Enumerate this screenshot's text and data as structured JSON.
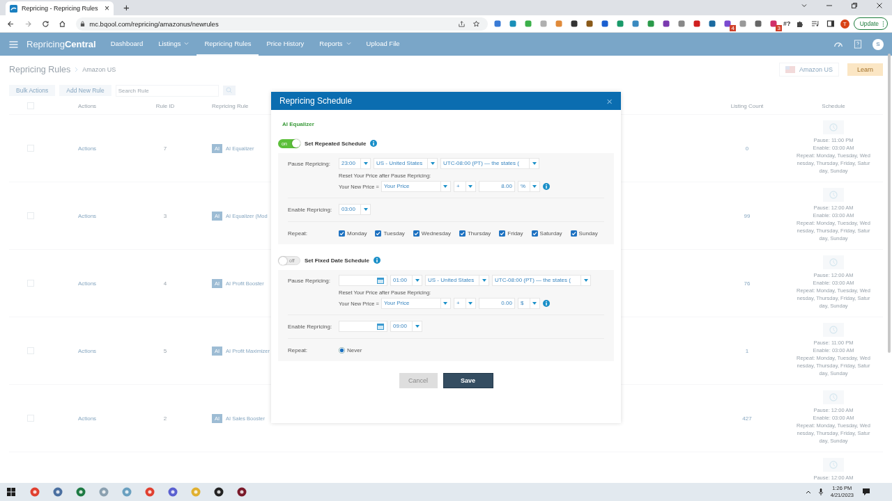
{
  "browser": {
    "tab": {
      "title": "Repricing - Repricing Rules",
      "close": "×"
    },
    "new_tab": "+",
    "url": "mc.bqool.com/repricing/amazonus/newrules",
    "extensions": [
      {
        "kind": "icon"
      },
      {
        "kind": "icon"
      },
      {
        "kind": "icon"
      },
      {
        "kind": "icon"
      },
      {
        "kind": "icon"
      },
      {
        "kind": "icon"
      },
      {
        "kind": "icon"
      },
      {
        "kind": "icon"
      },
      {
        "kind": "icon"
      },
      {
        "kind": "icon"
      },
      {
        "kind": "icon"
      },
      {
        "kind": "icon"
      },
      {
        "kind": "icon"
      },
      {
        "kind": "icon"
      },
      {
        "kind": "icon"
      },
      {
        "kind": "icon",
        "badge": "4"
      },
      {
        "kind": "icon"
      },
      {
        "kind": "icon"
      },
      {
        "kind": "icon",
        "badge": "3"
      },
      {
        "kind": "text",
        "label": "#?"
      }
    ],
    "profile": "T",
    "update_button": "Update"
  },
  "app_nav": {
    "logo_light": "Repricing",
    "logo_bold": "Central",
    "items": [
      {
        "label": "Dashboard",
        "dropdown": false,
        "selected": false
      },
      {
        "label": "Listings",
        "dropdown": true,
        "selected": false
      },
      {
        "label": "Repricing Rules",
        "dropdown": false,
        "selected": true
      },
      {
        "label": "Price History",
        "dropdown": false,
        "selected": false
      },
      {
        "label": "Reports",
        "dropdown": true,
        "selected": false
      },
      {
        "label": "Upload File",
        "dropdown": false,
        "selected": false
      }
    ],
    "avatar": "S"
  },
  "page": {
    "title": "Repricing Rules",
    "breadcrumb": "Amazon US",
    "marketplace": "Amazon US",
    "learn_button": "Learn",
    "bulk_actions": "Bulk Actions",
    "add_rule": "Add New Rule",
    "search_placeholder": "Search Rule"
  },
  "table": {
    "columns": [
      {
        "kind": "checkbox",
        "checked": false
      },
      {
        "kind": "text",
        "label": "Actions"
      },
      {
        "kind": "text",
        "label": "Rule ID"
      },
      {
        "kind": "text",
        "label": "Repricing Rule"
      },
      {
        "kind": "text",
        "label": "Listing Count"
      },
      {
        "kind": "text",
        "label": "Schedule"
      }
    ],
    "rows": [
      {
        "checked": false,
        "actions": "Actions",
        "rule_id": "7",
        "badge": "AI",
        "rule": "AI Equalizer",
        "listing_count": "0",
        "schedule": [
          "Pause: 11:00 PM",
          "Enable: 03:00 AM",
          "Repeat: Monday, Tuesday, Wednesday, Thursday, Friday, Saturday, Sunday"
        ]
      },
      {
        "checked": false,
        "actions": "Actions",
        "rule_id": "3",
        "badge": "AI",
        "rule": "AI Equalizer (Mod",
        "listing_count": "99",
        "schedule": [
          "Pause: 12:00 AM",
          "Enable: 03:00 AM",
          "Repeat: Monday, Tuesday, Wednesday, Thursday, Friday, Saturday, Sunday"
        ]
      },
      {
        "checked": false,
        "actions": "Actions",
        "rule_id": "4",
        "badge": "AI",
        "rule": "AI Profit Booster",
        "listing_count": "76",
        "schedule": [
          "Pause: 12:00 AM",
          "Enable: 03:00 AM",
          "Repeat: Monday, Tuesday, Wednesday, Thursday, Friday, Saturday, Sunday"
        ]
      },
      {
        "checked": false,
        "actions": "Actions",
        "rule_id": "5",
        "badge": "AI",
        "rule": "AI Profit Maximizer",
        "listing_count": "1",
        "schedule": [
          "Pause: 11:00 PM",
          "Enable: 03:00 AM",
          "Repeat: Monday, Tuesday, Wednesday, Thursday, Friday, Saturday, Sunday"
        ]
      },
      {
        "checked": false,
        "actions": "Actions",
        "rule_id": "2",
        "badge": "AI",
        "rule": "AI Sales Booster",
        "listing_count": "427",
        "schedule": [
          "Pause: 12:00 AM",
          "Enable: 03:00 AM",
          "Repeat: Monday, Tuesday, Wednesday, Thursday, Friday, Saturday, Sunday"
        ]
      },
      {
        "schedule": [
          "Pause: 12:00 AM"
        ]
      }
    ]
  },
  "modal": {
    "title": "Repricing Schedule",
    "close": "×",
    "rule_name": "AI Equalizer",
    "schedules": [
      {
        "on": true,
        "toggle_text": "on",
        "title": "Set Repeated Schedule",
        "pause_label": "Pause Repricing:",
        "pause_fields": [
          {
            "kind": "select",
            "value": "23:00"
          },
          {
            "kind": "select",
            "value": "US - United States"
          },
          {
            "kind": "select",
            "value": "UTC-08:00 (PT) — the states ("
          }
        ],
        "reset_label": "Reset Your Price after Pause Repricing:",
        "new_price_label": "Your New Price =",
        "price_fields": [
          {
            "kind": "select",
            "value": "Your Price"
          },
          {
            "kind": "select",
            "value": "+"
          },
          {
            "kind": "input",
            "value": "8.00"
          },
          {
            "kind": "select",
            "value": "%"
          }
        ],
        "enable_label": "Enable Repricing:",
        "enable_fields": [
          {
            "kind": "select",
            "value": "03:00"
          }
        ],
        "repeat_label": "Repeat:",
        "repeat_options": [
          {
            "kind": "checkbox",
            "label": "Monday",
            "checked": true
          },
          {
            "kind": "checkbox",
            "label": "Tuesday",
            "checked": true
          },
          {
            "kind": "checkbox",
            "label": "Wednesday",
            "checked": true
          },
          {
            "kind": "checkbox",
            "label": "Thursday",
            "checked": true
          },
          {
            "kind": "checkbox",
            "label": "Friday",
            "checked": true
          },
          {
            "kind": "checkbox",
            "label": "Saturday",
            "checked": true
          },
          {
            "kind": "checkbox",
            "label": "Sunday",
            "checked": true
          }
        ]
      },
      {
        "on": false,
        "toggle_text": "off",
        "title": "Set Fixed Date Schedule",
        "pause_label": "Pause Repricing:",
        "pause_fields": [
          {
            "kind": "date"
          },
          {
            "kind": "select",
            "value": "01:00"
          },
          {
            "kind": "select",
            "value": "US - United States"
          },
          {
            "kind": "select",
            "value": "UTC-08:00 (PT) — the states ("
          }
        ],
        "reset_label": "Reset Your Price after Pause Repricing:",
        "new_price_label": "Your New Price =",
        "price_fields": [
          {
            "kind": "select",
            "value": "Your Price"
          },
          {
            "kind": "select",
            "value": "+"
          },
          {
            "kind": "input",
            "value": "0.00"
          },
          {
            "kind": "select",
            "value": "$"
          }
        ],
        "enable_label": "Enable Repricing:",
        "enable_fields": [
          {
            "kind": "date"
          },
          {
            "kind": "select",
            "value": "09:00"
          }
        ],
        "repeat_label": "Repeat:",
        "repeat_options": [
          {
            "kind": "radio",
            "label": "Never",
            "selected": true
          }
        ]
      }
    ],
    "buttons": [
      {
        "kind": "cancel",
        "label": "Cancel",
        "disabled": true
      },
      {
        "kind": "save",
        "label": "Save",
        "disabled": false
      }
    ]
  },
  "taskbar": {
    "time": "1:26 PM",
    "date": "4/21/2023"
  }
}
